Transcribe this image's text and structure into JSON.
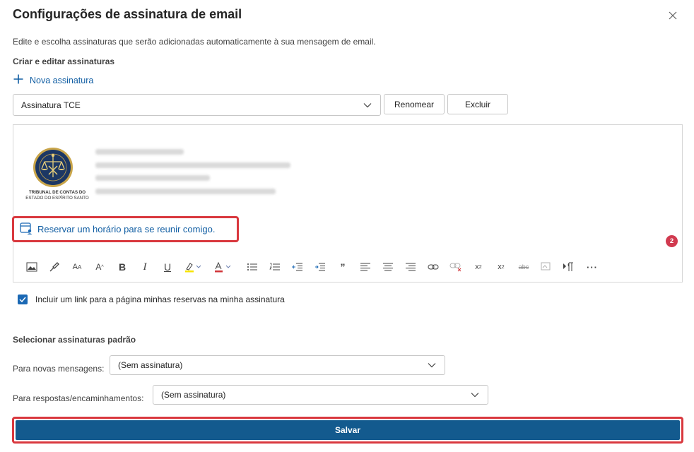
{
  "dialog": {
    "title": "Configurações de assinatura de email",
    "description": "Edite e escolha assinaturas que serão adicionadas automaticamente à sua mensagem de email."
  },
  "create_section": {
    "label": "Criar e editar assinaturas",
    "new_signature_label": "Nova assinatura",
    "selected_signature": "Assinatura TCE",
    "rename_label": "Renomear",
    "delete_label": "Excluir"
  },
  "editor": {
    "logo_text_line1": "TRIBUNAL DE CONTAS DO",
    "logo_text_line2": "ESTADO DO ESPÍRITO SANTO",
    "booking_link": "Reservar um horário para se reunir comigo.",
    "badge_count": "2",
    "toolbar_icons": [
      "image-icon",
      "format-painter-icon",
      "font-size-icon",
      "increase-font-icon",
      "bold-icon",
      "italic-icon",
      "underline-icon",
      "highlight-icon",
      "font-color-icon",
      "bullets-icon",
      "numbering-icon",
      "decrease-indent-icon",
      "increase-indent-icon",
      "quote-icon",
      "align-left-icon",
      "align-center-icon",
      "align-right-icon",
      "link-icon",
      "unlink-icon",
      "superscript-icon",
      "subscript-icon",
      "strikethrough-icon",
      "clear-format-icon",
      "ltr-icon",
      "more-icon"
    ]
  },
  "include_link": {
    "checked": true,
    "label": "Incluir um link para a página minhas reservas na minha assinatura"
  },
  "defaults": {
    "label": "Selecionar assinaturas padrão",
    "new_messages_label": "Para novas mensagens:",
    "new_messages_value": "(Sem assinatura)",
    "replies_label": "Para respostas/encaminhamentos:",
    "replies_value": "(Sem assinatura)"
  },
  "save_label": "Salvar",
  "colors": {
    "accent": "#115ea3",
    "save_bg": "#135a8e",
    "highlight_border": "#d9383e",
    "badge": "#d13a4f"
  }
}
